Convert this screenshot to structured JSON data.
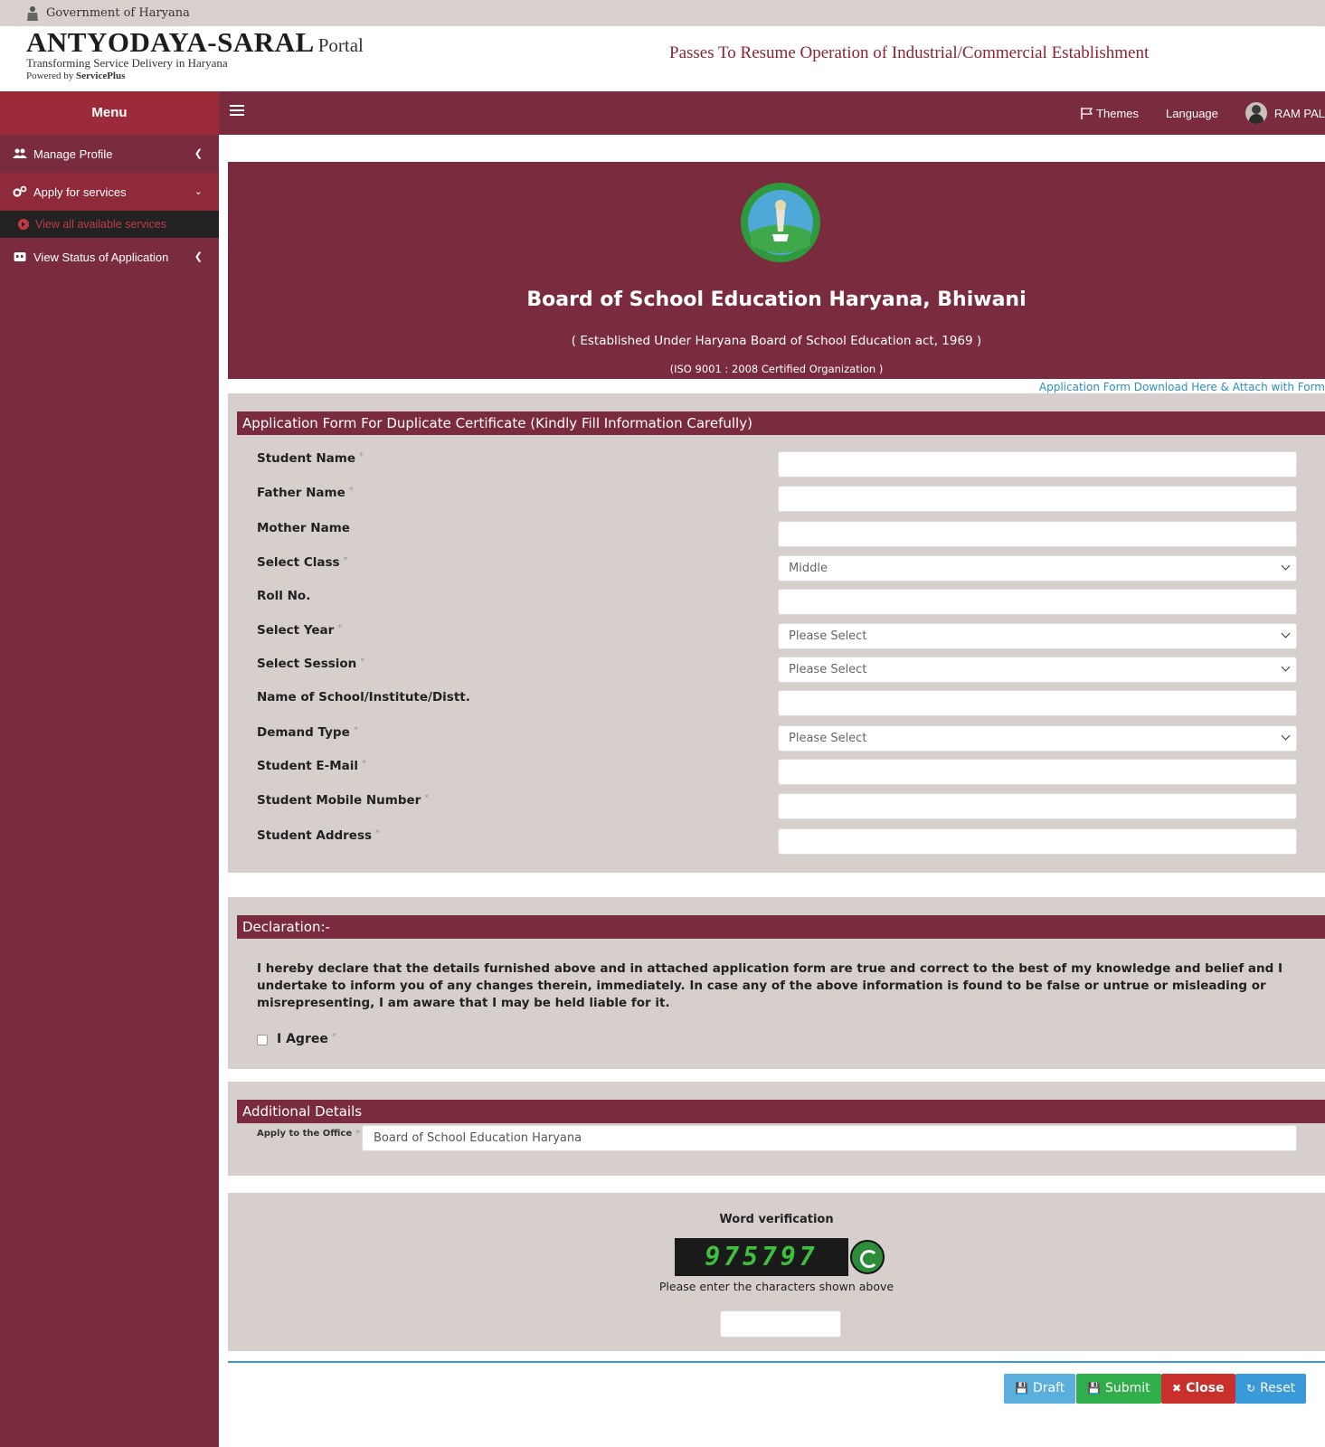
{
  "gov_bar": {
    "text": "Government of Haryana"
  },
  "header": {
    "brand": "ANTYODAYA-SARAL",
    "brand_suffix": "Portal",
    "tagline": "Transforming Service Delivery in Haryana",
    "powered_prefix": "Powered by ",
    "powered_name": "ServicePlus",
    "service_title": "Passes To Resume Operation of Industrial/Commercial Establishment"
  },
  "navbar": {
    "menu_label": "Menu",
    "themes_label": "Themes",
    "language_label": "Language",
    "user_name": "RAM PAL"
  },
  "sidebar": {
    "items": [
      {
        "label": "Manage Profile"
      },
      {
        "label": "Apply for services"
      },
      {
        "label": "View Status of Application"
      }
    ],
    "sub_item": "View all available services"
  },
  "banner": {
    "board_name": "Board of School Education Haryana, Bhiwani",
    "established": "( Established Under Haryana Board of School Education act, 1969 )",
    "iso": "(ISO 9001 : 2008 Certified Organization )"
  },
  "download_link": "Application Form Download Here & Attach with Form",
  "form": {
    "title": "Application Form For Duplicate Certificate (Kindly Fill Information Carefully)",
    "fields": [
      {
        "label": "Student Name",
        "required": "*"
      },
      {
        "label": "Father Name",
        "required": "*"
      },
      {
        "label": "Mother Name"
      },
      {
        "label": "Select Class",
        "required": "*",
        "value": "Middle"
      },
      {
        "label": "Roll No."
      },
      {
        "label": "Select Year",
        "required": "*",
        "value": "Please Select"
      },
      {
        "label": "Select Session",
        "required": "*",
        "value": "Please Select"
      },
      {
        "label": "Name of School/Institute/Distt."
      },
      {
        "label": "Demand Type",
        "required": "*",
        "value": "Please Select"
      },
      {
        "label": "Student E-Mail",
        "required": "*"
      },
      {
        "label": "Student Mobile Number",
        "required": "*"
      },
      {
        "label": "Student Address",
        "required": "*"
      }
    ]
  },
  "declaration": {
    "title": "Declaration:-",
    "text": "I hereby declare that the details furnished above and in attached application form are true and correct to the best of my knowledge and belief and I undertake to inform you of any changes therein, immediately. In case any of the above information is found to be false or untrue or misleading or misrepresenting, I am aware that I may be held liable for it.",
    "agree_label": "I Agree",
    "required": "*"
  },
  "additional": {
    "title": "Additional Details",
    "office_label": "Apply to the Office",
    "required": "*",
    "office_value": "Board of School Education Haryana"
  },
  "verification": {
    "title": "Word verification",
    "captcha": "975797",
    "hint": "Please enter the characters shown above"
  },
  "actions": {
    "draft": "Draft",
    "submit": "Submit",
    "close": "Close",
    "reset": "Reset"
  }
}
